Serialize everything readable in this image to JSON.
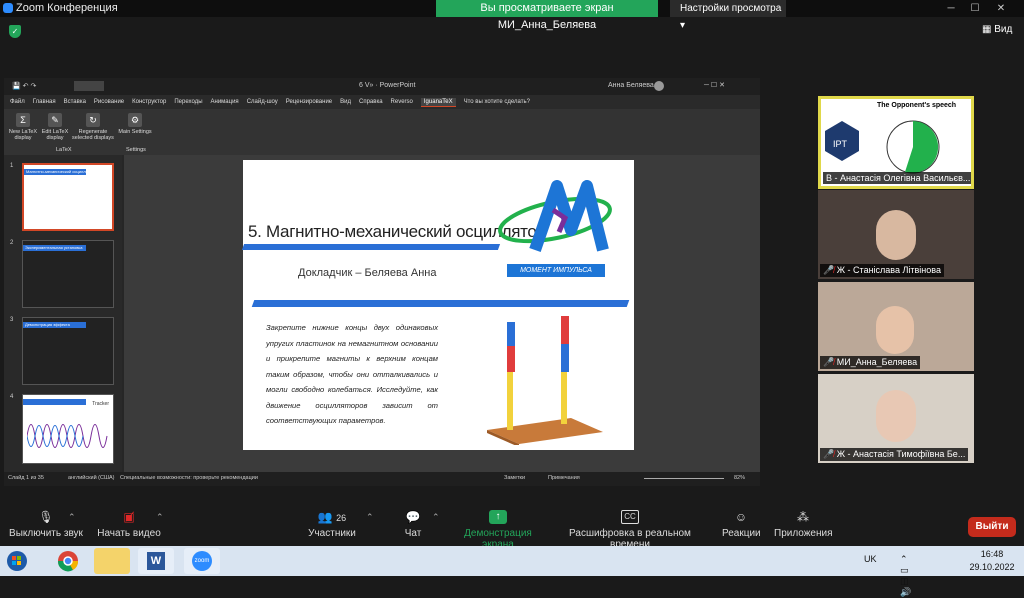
{
  "zoom": {
    "window_title": "Zoom Конференция",
    "share_banner": "Вы просматриваете экран МИ_Анна_Беляева",
    "view_options": "Настройки просмотра",
    "view_button": "Вид"
  },
  "powerpoint": {
    "doc_title": "6 V» · PowerPoint",
    "user": "Анна Беляева",
    "tabs": [
      "Файл",
      "Главная",
      "Вставка",
      "Рисование",
      "Конструктор",
      "Переходы",
      "Анимация",
      "Слайд-шоу",
      "Рецензирование",
      "Вид",
      "Справка",
      "Reverso",
      "IguanaTeX",
      "Что вы хотите сделать?"
    ],
    "active_tab_index": 12,
    "ribbon_buttons": [
      {
        "label": "New LaTeX display",
        "icon": "sigma-icon"
      },
      {
        "label": "Edit LaTeX display",
        "icon": "edit-doc-icon"
      },
      {
        "label": "Regenerate selected displays",
        "icon": "refresh-icon"
      },
      {
        "label": "Main Settings",
        "icon": "settings-icon"
      }
    ],
    "ribbon_groups": [
      "LaTeX",
      "Settings"
    ],
    "thumbnails": [
      {
        "num": "1",
        "label": "Магнитно-механический осциллятор"
      },
      {
        "num": "2",
        "label": "Экспериментальная установка"
      },
      {
        "num": "3",
        "label": "Демонстрация эффекта"
      },
      {
        "num": "4",
        "label": "Tracker"
      }
    ],
    "status_left": "Слайд 1 из 35",
    "status_lang": "английский (США)",
    "status_access": "Специальные возможности: проверьте рекомендации",
    "status_notes": "Заметки",
    "status_comments": "Примечания",
    "zoom_percent": "82%"
  },
  "slide": {
    "title": "5. Магнитно-механический осциллятор",
    "speaker": "Докладчик – Беляева Анна",
    "body": "Закрепите нижние концы двух одинаковых упругих пластинок на немагнитном основании и прикрепите магниты к верхним концам таким образом, чтобы они отталкивались и могли свободно колебаться. Исследуйте, как движение осцилляторов зависит от соответствующих параметров.",
    "logo_text": "МОМЕНТ ИМПУЛЬСА"
  },
  "participants": [
    {
      "label": "В - Анастасія Олегівна Васильєв...",
      "tile_title": "The Opponent's speech",
      "muted": false,
      "active": true
    },
    {
      "label": "Ж - Станіслава Літвінова",
      "muted": true
    },
    {
      "label": "МИ_Анна_Беляева",
      "muted": true
    },
    {
      "label": "Ж - Анастасія Тимофіївна Бе...",
      "muted": true
    }
  ],
  "toolbar": {
    "mute": "Выключить звук",
    "video": "Начать видео",
    "participants": "Участники",
    "participants_count": "26",
    "chat": "Чат",
    "share": "Демонстрация экрана",
    "transcript": "Расшифровка в реальном времени",
    "reactions": "Реакции",
    "apps": "Приложения",
    "leave": "Выйти"
  },
  "taskbar": {
    "lang": "UK",
    "time": "16:48",
    "date": "29.10.2022",
    "apps": [
      "start-icon",
      "chrome-icon",
      "file-explorer-icon",
      "word-icon",
      "zoom-icon"
    ]
  },
  "colors": {
    "accent_blue": "#2a6fd6",
    "share_green": "#23a55a",
    "leave_red": "#c42b1c",
    "active_speaker": "#e0d84a"
  }
}
